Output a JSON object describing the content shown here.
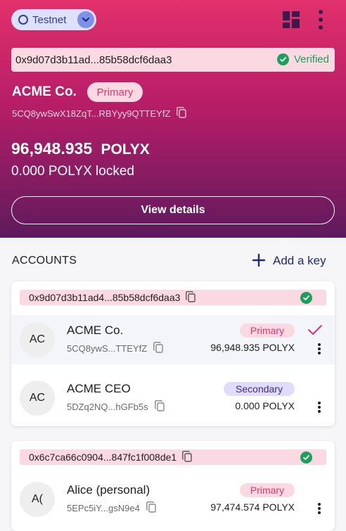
{
  "network": {
    "label": "Testnet"
  },
  "identity": {
    "did": "0x9d07d3b11ad...85b58dcf6daa3",
    "verified_label": "Verified",
    "name": "ACME Co.",
    "role": "Primary",
    "address": "5CQ8ywSwX18ZqT...RBYyy9QTTEYfZ",
    "balance": "96,948.935",
    "currency": "POLYX",
    "locked": "0.000 POLYX  locked",
    "view_details": "View details"
  },
  "accounts_section": {
    "title": "ACCOUNTS",
    "add_key": "Add a key"
  },
  "key_groups": [
    {
      "did": "0x9d07d3b11ad4...85b58dcf6daa3",
      "accounts": [
        {
          "initials": "AC",
          "name": "ACME Co.",
          "role": "Primary",
          "address": "5CQ8ywS...TTEYfZ",
          "balance": "96,948.935 POLYX",
          "selected": true
        },
        {
          "initials": "AC",
          "name": "ACME CEO",
          "role": "Secondary",
          "address": "5DZq2NQ...hGFb5s",
          "balance": "0.000 POLYX",
          "selected": false
        }
      ]
    },
    {
      "did": "0x6c7ca66c0904...847fc1f008de1",
      "accounts": [
        {
          "initials": "A(",
          "name": "Alice (personal)",
          "role": "Primary",
          "address": "5EPc5iY...gsN9e4",
          "balance": "97,474.574 POLYX",
          "selected": false
        }
      ]
    }
  ],
  "colors": {
    "header_gradient_top": "#e2306b",
    "header_gradient_bottom": "#5e1a5d",
    "verified_green": "#1aa05c",
    "primary_pink": "#e0356b",
    "secondary_purple": "#3b2b93"
  },
  "icons": [
    "network-ring-icon",
    "chevron-down-icon",
    "dashboard-grid-icon",
    "more-vertical-icon",
    "check-circle-icon",
    "copy-icon",
    "plus-icon",
    "checkmark-icon"
  ]
}
